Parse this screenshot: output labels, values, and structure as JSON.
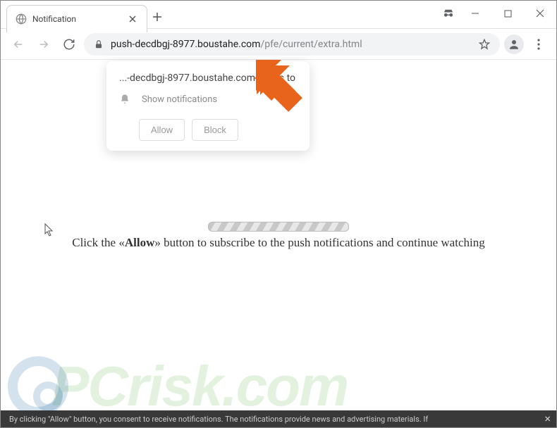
{
  "window": {
    "tab_title": "Notification"
  },
  "addressbar": {
    "host": "push-decdbgj-8977.boustahe.com",
    "path": "/pfe/current/extra.html"
  },
  "notification": {
    "origin": "...-decdbgj-8977.boustahe.com wants to",
    "permission_label": "Show notifications",
    "allow_label": "Allow",
    "block_label": "Block"
  },
  "page": {
    "instruction_prefix": "Click the «",
    "instruction_bold": "Allow",
    "instruction_suffix": "» button to subscribe to the push notifications and continue watching"
  },
  "footer": {
    "text": "By clicking \"Allow\" button, you consent to receive notifications. The notifications provide news and advertising materials. If"
  },
  "watermark": {
    "text": "PCrisk.com"
  },
  "colors": {
    "arrow": "#E8641B",
    "watermark_green": "rgba(102,175,77,0.18)",
    "watermark_blue": "rgba(41,111,166,0.2)"
  }
}
